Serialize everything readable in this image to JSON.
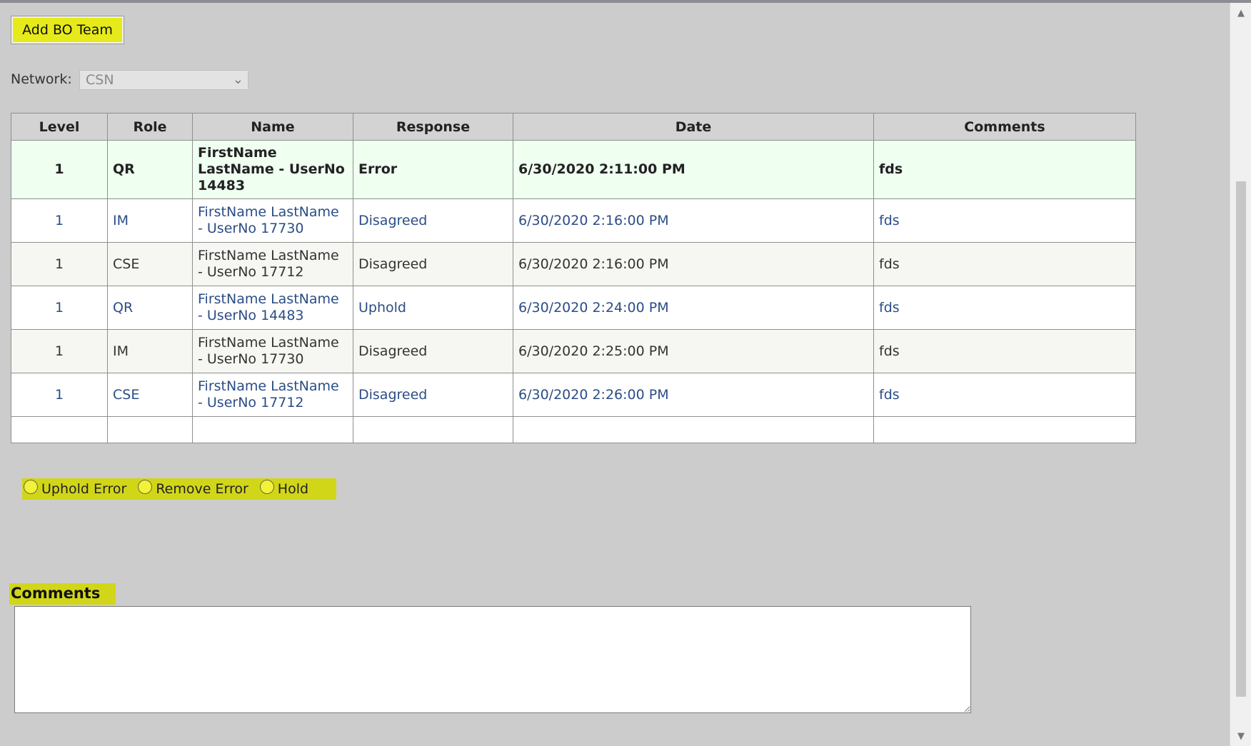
{
  "toolbar": {
    "add_team_label": "Add BO Team"
  },
  "network": {
    "label": "Network:",
    "selected": "CSN"
  },
  "table": {
    "headers": [
      "Level",
      "Role",
      "Name",
      "Response",
      "Date",
      "Comments"
    ],
    "rows": [
      {
        "level": "1",
        "role": "QR",
        "name": "FirstName LastName - UserNo 14483",
        "response": "Error",
        "date": "6/30/2020 2:11:00 PM",
        "comments": "fds"
      },
      {
        "level": "1",
        "role": "IM",
        "name": "FirstName LastName - UserNo 17730",
        "response": "Disagreed",
        "date": "6/30/2020 2:16:00 PM",
        "comments": "fds"
      },
      {
        "level": "1",
        "role": "CSE",
        "name": "FirstName LastName - UserNo 17712",
        "response": "Disagreed",
        "date": "6/30/2020 2:16:00 PM",
        "comments": "fds"
      },
      {
        "level": "1",
        "role": "QR",
        "name": "FirstName LastName - UserNo 14483",
        "response": "Uphold",
        "date": "6/30/2020 2:24:00 PM",
        "comments": "fds"
      },
      {
        "level": "1",
        "role": "IM",
        "name": "FirstName LastName - UserNo 17730",
        "response": "Disagreed",
        "date": "6/30/2020 2:25:00 PM",
        "comments": "fds"
      },
      {
        "level": "1",
        "role": "CSE",
        "name": "FirstName LastName - UserNo 17712",
        "response": "Disagreed",
        "date": "6/30/2020 2:26:00 PM",
        "comments": "fds"
      }
    ]
  },
  "decision": {
    "options": [
      "Uphold Error",
      "Remove Error",
      "Hold"
    ]
  },
  "comments": {
    "label": "Comments",
    "value": ""
  },
  "colors": {
    "highlight": "#d2d619",
    "link_text": "#2b4d86",
    "selected_row": "#effff0"
  }
}
